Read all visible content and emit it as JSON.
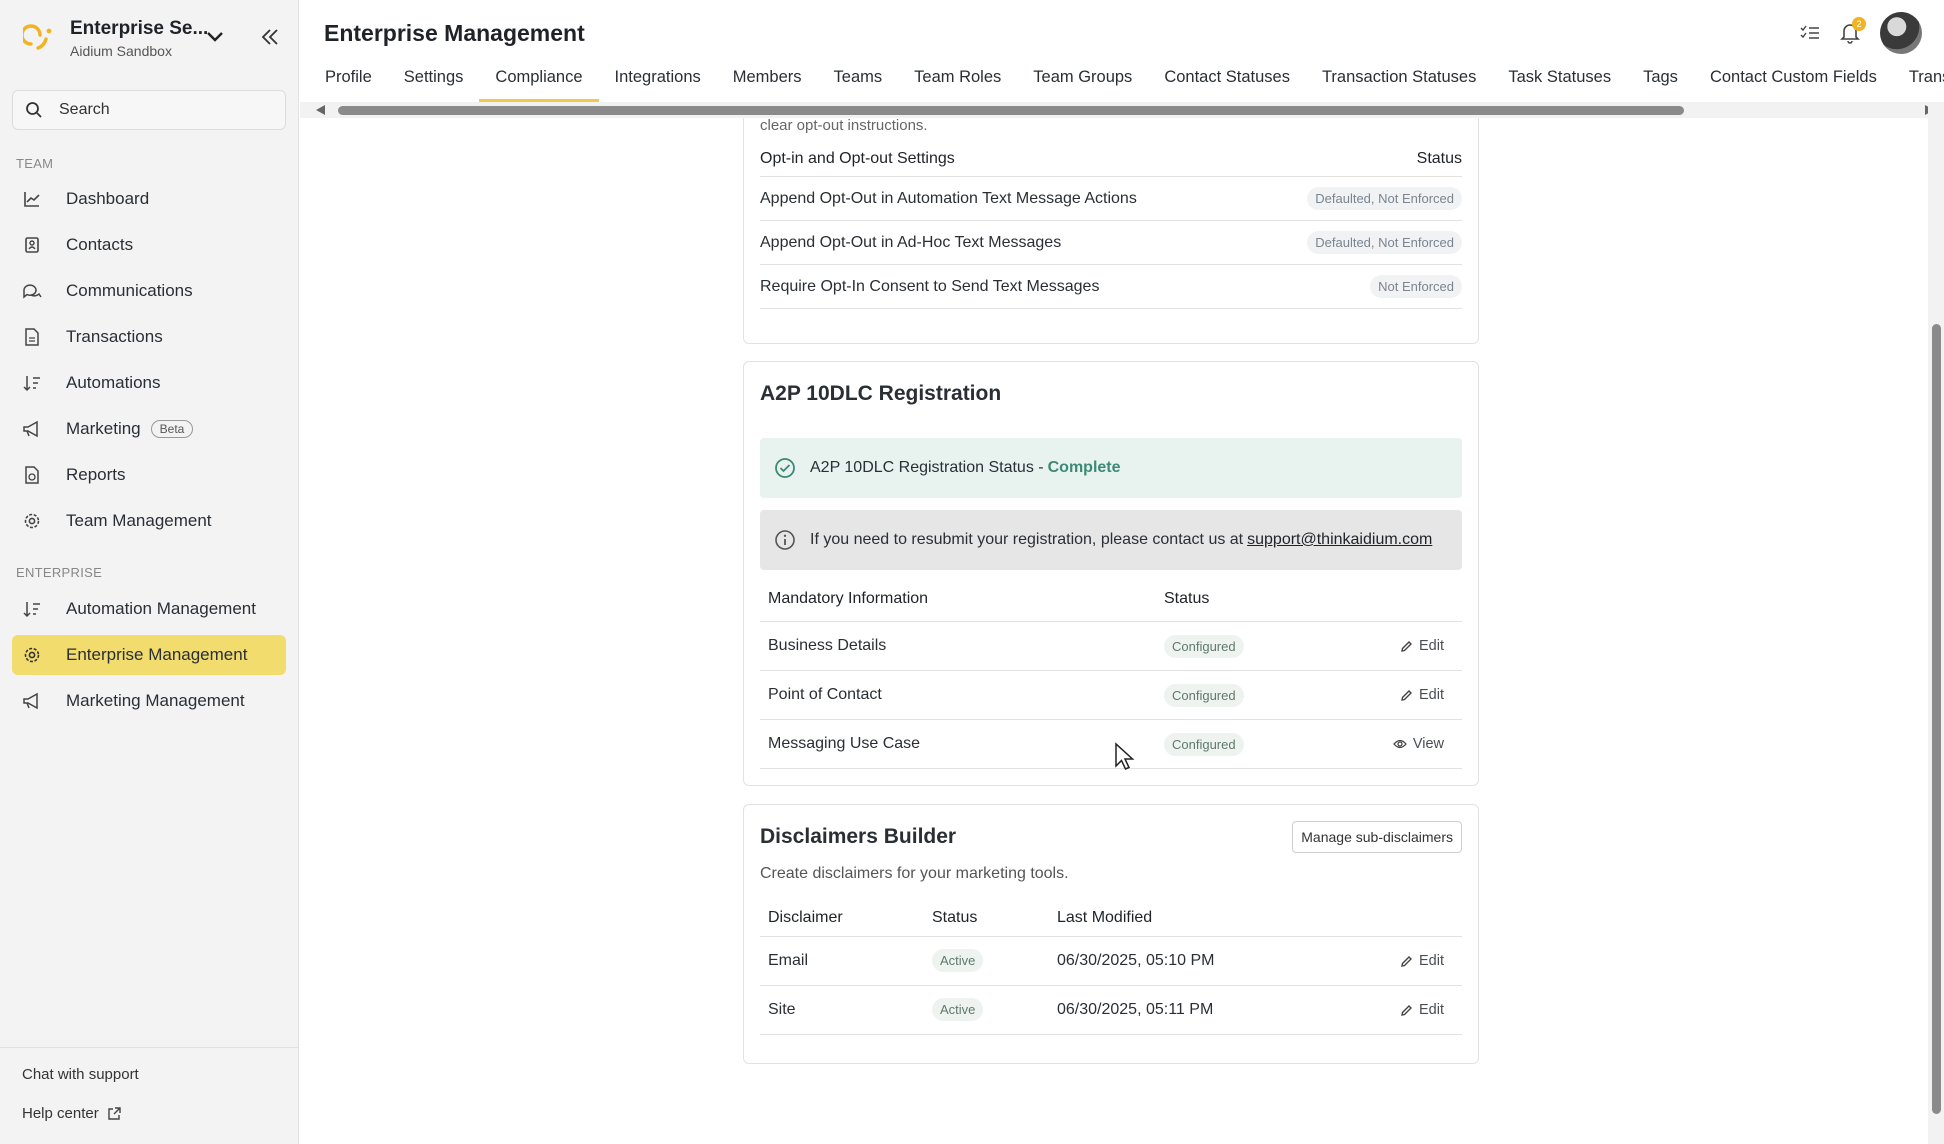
{
  "sidebar": {
    "org_name": "Enterprise Se...",
    "org_sub": "Aidium Sandbox",
    "search_placeholder": "Search",
    "team_label": "TEAM",
    "enterprise_label": "ENTERPRISE",
    "team_items": [
      {
        "label": "Dashboard",
        "icon": "chart-line-icon"
      },
      {
        "label": "Contacts",
        "icon": "contacts-icon"
      },
      {
        "label": "Communications",
        "icon": "chat-icon"
      },
      {
        "label": "Transactions",
        "icon": "document-icon"
      },
      {
        "label": "Automations",
        "icon": "automation-icon"
      },
      {
        "label": "Marketing",
        "icon": "megaphone-icon",
        "badge": "Beta"
      },
      {
        "label": "Reports",
        "icon": "report-icon"
      },
      {
        "label": "Team Management",
        "icon": "gear-icon"
      }
    ],
    "enterprise_items": [
      {
        "label": "Automation Management",
        "icon": "automation-icon"
      },
      {
        "label": "Enterprise Management",
        "icon": "gear-icon",
        "active": true
      },
      {
        "label": "Marketing Management",
        "icon": "megaphone-icon"
      }
    ],
    "chat_support": "Chat with support",
    "help_center": "Help center"
  },
  "header": {
    "title": "Enterprise Management",
    "notification_count": "2",
    "tabs": [
      "Profile",
      "Settings",
      "Compliance",
      "Integrations",
      "Members",
      "Teams",
      "Team Roles",
      "Team Groups",
      "Contact Statuses",
      "Transaction Statuses",
      "Task Statuses",
      "Tags",
      "Contact Custom Fields",
      "Transaction Cu"
    ],
    "active_tab": "Compliance"
  },
  "optin": {
    "cut_text": "clear opt-out instructions.",
    "col_setting": "Opt-in and Opt-out Settings",
    "col_status": "Status",
    "rows": [
      {
        "label": "Append Opt-Out in Automation Text Message Actions",
        "status": "Defaulted, Not Enforced"
      },
      {
        "label": "Append Opt-Out in Ad-Hoc Text Messages",
        "status": "Defaulted, Not Enforced"
      },
      {
        "label": "Require Opt-In Consent to Send Text Messages",
        "status": "Not Enforced"
      }
    ]
  },
  "a2p": {
    "title": "A2P 10DLC Registration",
    "status_text": "A2P 10DLC Registration Status -",
    "status_value": "Complete",
    "info_text": "If you need to resubmit your registration, please contact us at",
    "info_email": "support@thinkaidium.com",
    "col_info": "Mandatory Information",
    "col_status": "Status",
    "rows": [
      {
        "label": "Business Details",
        "status": "Configured",
        "action": "Edit"
      },
      {
        "label": "Point of Contact",
        "status": "Configured",
        "action": "Edit"
      },
      {
        "label": "Messaging Use Case",
        "status": "Configured",
        "action": "View"
      }
    ]
  },
  "disclaimers": {
    "title": "Disclaimers Builder",
    "manage_button": "Manage sub-disclaimers",
    "description": "Create disclaimers for your marketing tools.",
    "col_disclaimer": "Disclaimer",
    "col_status": "Status",
    "col_modified": "Last Modified",
    "rows": [
      {
        "label": "Email",
        "status": "Active",
        "modified": "06/30/2025, 05:10 PM",
        "action": "Edit"
      },
      {
        "label": "Site",
        "status": "Active",
        "modified": "06/30/2025, 05:11 PM",
        "action": "Edit"
      }
    ]
  },
  "colors": {
    "accent": "#f2dc6d",
    "success": "#3d8a73"
  }
}
